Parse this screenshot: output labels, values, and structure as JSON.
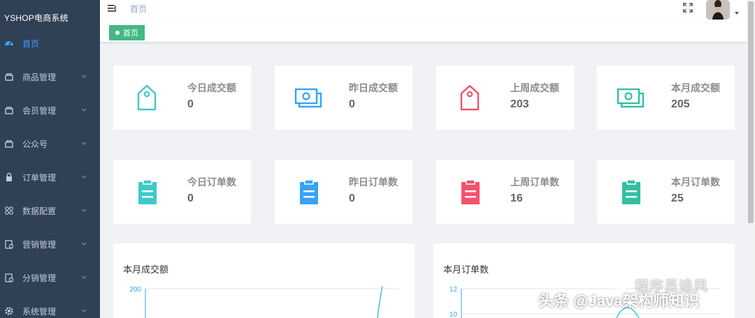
{
  "app": {
    "brand": "YSHOP电商系统"
  },
  "sidebar": {
    "items": [
      {
        "label": "首页",
        "icon": "dashboard-icon",
        "active": true
      },
      {
        "label": "商品管理",
        "icon": "shop-icon",
        "active": false
      },
      {
        "label": "会员管理",
        "icon": "member-icon",
        "active": false
      },
      {
        "label": "公众号",
        "icon": "wechat-icon",
        "active": false
      },
      {
        "label": "订单管理",
        "icon": "lock-icon",
        "active": false
      },
      {
        "label": "数据配置",
        "icon": "grid-icon",
        "active": false
      },
      {
        "label": "营销管理",
        "icon": "marketing-icon",
        "active": false
      },
      {
        "label": "分销管理",
        "icon": "distribution-icon",
        "active": false
      },
      {
        "label": "系统管理",
        "icon": "gear-icon",
        "active": false
      }
    ]
  },
  "navbar": {
    "breadcrumb": "首页"
  },
  "tags": [
    {
      "label": "首页",
      "active": true
    }
  ],
  "stats": {
    "row1": [
      {
        "label": "今日成交额",
        "value": "0",
        "icon": "tag-icon",
        "color": "#40c9c6"
      },
      {
        "label": "昨日成交额",
        "value": "0",
        "icon": "money-icon",
        "color": "#36a3f7"
      },
      {
        "label": "上周成交额",
        "value": "203",
        "icon": "tag-icon",
        "color": "#f4516c"
      },
      {
        "label": "本月成交额",
        "value": "205",
        "icon": "money-icon",
        "color": "#34bfa3"
      }
    ],
    "row2": [
      {
        "label": "今日订单数",
        "value": "0",
        "icon": "clipboard-icon",
        "color": "#40c9c6"
      },
      {
        "label": "昨日订单数",
        "value": "0",
        "icon": "clipboard-icon",
        "color": "#36a3f7"
      },
      {
        "label": "上周订单数",
        "value": "16",
        "icon": "clipboard-icon",
        "color": "#f4516c"
      },
      {
        "label": "本月订单数",
        "value": "25",
        "icon": "clipboard-icon",
        "color": "#34bfa3"
      }
    ]
  },
  "charts": [
    {
      "title": "本月成交额",
      "y_tick_top": "200"
    },
    {
      "title": "本月订单数",
      "y_tick_top": "12",
      "y_tick_second": "10"
    }
  ],
  "watermark": {
    "line1": "程序员追风",
    "line2": "头条 @Java架构师知识"
  }
}
